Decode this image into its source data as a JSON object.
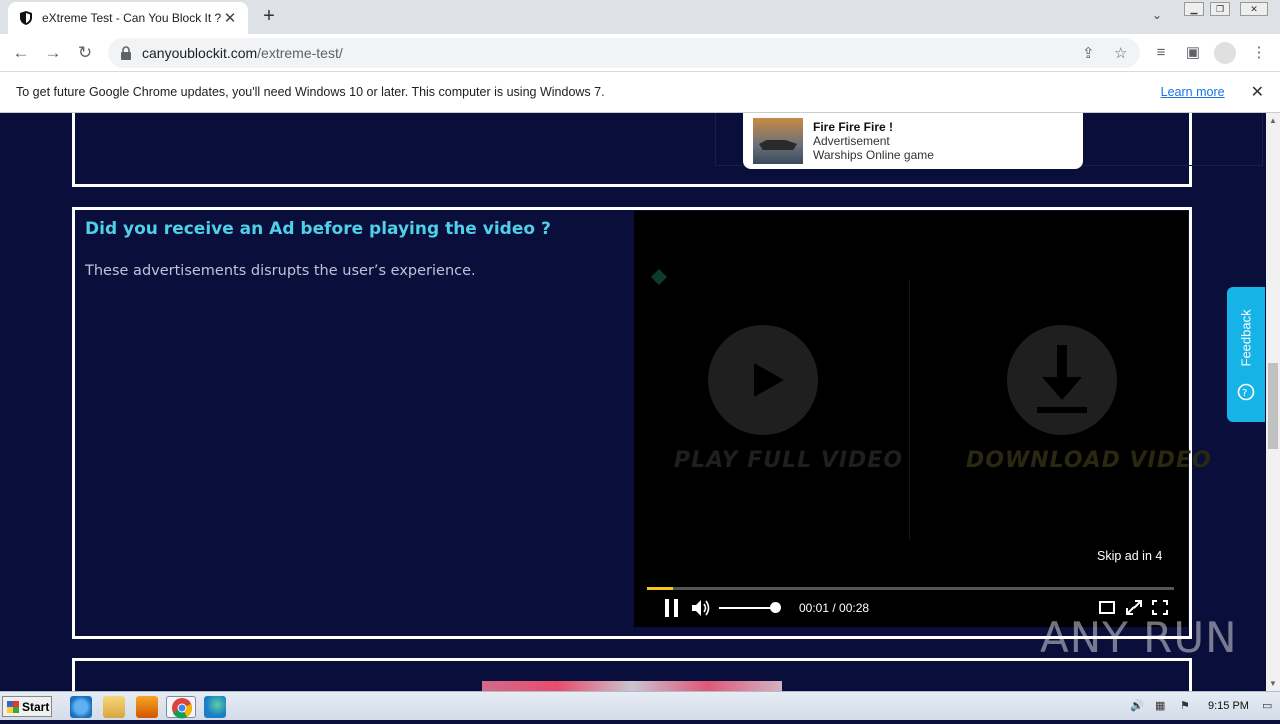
{
  "browser": {
    "tab_title": "eXtreme Test - Can You Block It ?",
    "new_tab": "+",
    "url_host": "canyoublockit.com",
    "url_path": "/extreme-test/"
  },
  "infobar": {
    "message": "To get future Google Chrome updates, you'll need Windows 10 or later. This computer is using Windows 7.",
    "link": "Learn more",
    "close": "✕"
  },
  "ad_card": {
    "title": "Fire Fire Fire !",
    "label": "Advertisement",
    "subtitle": "Warships Online game"
  },
  "section": {
    "heading": "Did you receive an Ad before playing the video ?",
    "description": "These advertisements disrupts the user’s experience."
  },
  "player": {
    "left_label": "PLAY FULL VIDEO",
    "right_label": "DOWNLOAD VIDEO",
    "skip_text": "Skip ad in 4",
    "time": "00:01 / 00:28",
    "progress": 0.05
  },
  "feedback": {
    "label": "Feedback"
  },
  "watermark": "ANY RUN",
  "taskbar": {
    "start": "Start",
    "clock": "9:15 PM"
  },
  "colors": {
    "heading": "#4fd0e8",
    "page_bg": "#0a0e3a",
    "feedback": "#16b3e6"
  }
}
